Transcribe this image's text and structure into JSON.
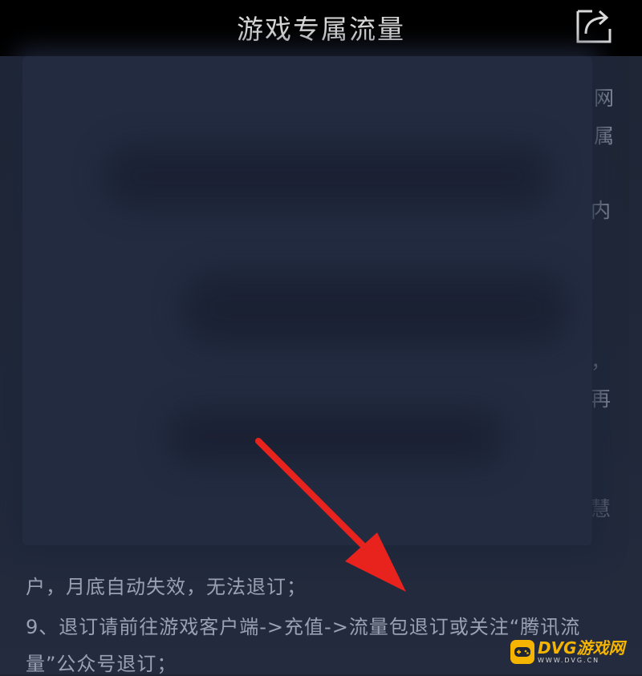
{
  "header": {
    "title": "游戏专属流量"
  },
  "side_fragments": [
    {
      "id": "wang",
      "text": "网"
    },
    {
      "id": "shu",
      "text": "属"
    },
    {
      "id": "nei",
      "text": "内"
    },
    {
      "id": "comma",
      "text": "，"
    },
    {
      "id": "zai",
      "text": "再"
    },
    {
      "id": "partial",
      "text": "慧"
    }
  ],
  "content": {
    "line1": "户，月底自动失效，无法退订；",
    "line2": "9、退订请前往游戏客户端->充值->流量包退订或关注“腾讯流",
    "line3": "量”公众号退订；"
  },
  "annotation": {
    "arrow_color": "#e8231e"
  },
  "watermark": {
    "brand": "DVG游戏网",
    "url": "WWW.DVG.CN",
    "color": "#f4b400"
  }
}
